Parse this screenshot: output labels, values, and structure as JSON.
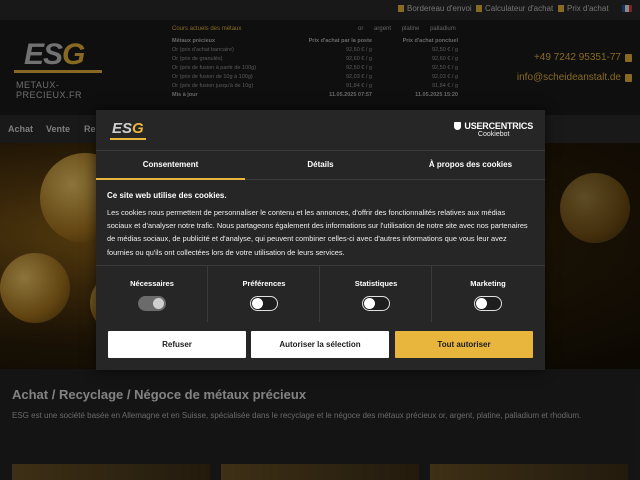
{
  "topbar": {
    "links": [
      {
        "label": "Bordereau d'envoi"
      },
      {
        "label": "Calculateur d'achat"
      },
      {
        "label": "Prix d'achat"
      }
    ]
  },
  "logo": {
    "text_main": "ES",
    "text_accent": "G",
    "subtitle": "METAUX-PRECIEUX.FR"
  },
  "prices": {
    "title": "Cours actuels des métaux",
    "metal_tabs": [
      "or",
      "argent",
      "platine",
      "palladium"
    ],
    "header": {
      "c1": "Métaux précieux",
      "c2": "Prix d'achat par la poste",
      "c3": "Prix d'achat ponctuel"
    },
    "rows": [
      {
        "c1": "Or (prix d'achat bancaire)",
        "c2": "92,50 € / g",
        "c3": "92,50 € / g"
      },
      {
        "c1": "Or (prix de granulés)",
        "c2": "92,60 € / g",
        "c3": "92,60 € / g"
      },
      {
        "c1": "Or (prix de fusion à partir de 100g)",
        "c2": "92,50 € / g",
        "c3": "92,50 € / g"
      },
      {
        "c1": "Or (prix de fusion de 10g à 100g)",
        "c2": "92,03 € / g",
        "c3": "92,03 € / g"
      },
      {
        "c1": "Or (prix de fusion jusqu'à de 10g)",
        "c2": "91,84 € / g",
        "c3": "91,84 € / g"
      }
    ],
    "footer": {
      "c1": "Mis à jour",
      "c2": "11.05.2025 07:57",
      "c3": "11.05.2025 15:20"
    }
  },
  "contact": {
    "phone": "+49 7242 95351-77",
    "email": "info@scheideanstalt.de"
  },
  "nav": {
    "items": [
      "Achat",
      "Vente",
      "Re"
    ]
  },
  "content": {
    "heading": "Achat / Recyclage / Négoce de métaux précieux",
    "intro": "ESG est une société basée en Allemagne et en Suisse, spécialisée dans le recyclage et le négoce des métaux précieux or, argent, platine, palladium et rhodium."
  },
  "dialog": {
    "logo_main": "ES",
    "logo_accent": "G",
    "brand_top": "USERCENTRICS",
    "brand_bottom": "Cookiebot",
    "tabs": [
      "Consentement",
      "Détails",
      "À propos des cookies"
    ],
    "active_tab": 0,
    "title": "Ce site web utilise des cookies.",
    "text": "Les cookies nous permettent de personnaliser le contenu et les annonces, d'offrir des fonctionnalités relatives aux médias sociaux et d'analyser notre trafic. Nous partageons également des informations sur l'utilisation de notre site avec nos partenaires de médias sociaux, de publicité et d'analyse, qui peuvent combiner celles-ci avec d'autres informations que vous leur avez fournies ou qu'ils ont collectées lors de votre utilisation de leurs services.",
    "toggles": [
      {
        "label": "Nécessaires",
        "on": true,
        "locked": true
      },
      {
        "label": "Préférences",
        "on": false,
        "locked": false
      },
      {
        "label": "Statistiques",
        "on": false,
        "locked": false
      },
      {
        "label": "Marketing",
        "on": false,
        "locked": false
      }
    ],
    "buttons": {
      "refuse": "Refuser",
      "allow_selection": "Autoriser la sélection",
      "allow_all": "Tout autoriser"
    }
  },
  "colors": {
    "accent": "#e8b53d",
    "background": "#1d1d1d",
    "dialog": "#262626"
  }
}
